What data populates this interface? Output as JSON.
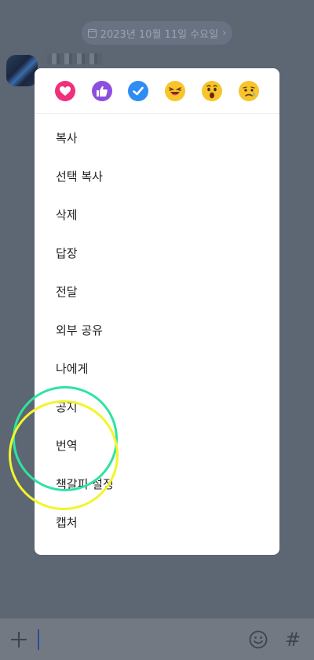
{
  "date_pill": {
    "label": "2023년 10월 11일 수요일",
    "chevron": "›"
  },
  "reactions": [
    {
      "name": "heart",
      "color": "#f0307a"
    },
    {
      "name": "thumbs-up",
      "color": "#8c4fe0"
    },
    {
      "name": "check",
      "color": "#2e8cf3"
    },
    {
      "name": "laughing-face",
      "color": "#f7c52b"
    },
    {
      "name": "surprised-face",
      "color": "#f7c52b"
    },
    {
      "name": "sad-face",
      "color": "#f7c52b"
    }
  ],
  "menu": {
    "items": [
      {
        "id": "copy",
        "label": "복사"
      },
      {
        "id": "select-copy",
        "label": "선택 복사"
      },
      {
        "id": "delete",
        "label": "삭제"
      },
      {
        "id": "reply",
        "label": "답장"
      },
      {
        "id": "forward",
        "label": "전달"
      },
      {
        "id": "share-external",
        "label": "외부 공유"
      },
      {
        "id": "to-me",
        "label": "나에게"
      },
      {
        "id": "notice",
        "label": "공지"
      },
      {
        "id": "translate",
        "label": "번역"
      },
      {
        "id": "bookmark",
        "label": "책갈피 설정"
      },
      {
        "id": "capture",
        "label": "캡처"
      }
    ]
  },
  "input_bar": {
    "hash_label": "#"
  }
}
